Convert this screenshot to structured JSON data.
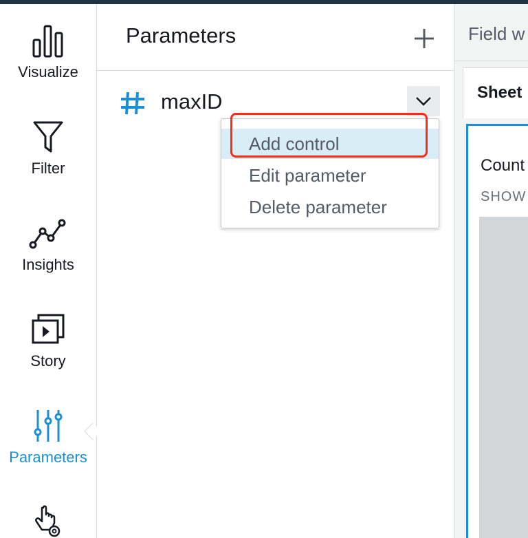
{
  "colors": {
    "accent": "#1a8fd6",
    "callout": "#ff2a14",
    "menu_highlight": "#d9edf7",
    "top_bar": "#1f3342"
  },
  "rail": {
    "items": [
      {
        "label": "Visualize",
        "icon": "bar-chart-icon"
      },
      {
        "label": "Filter",
        "icon": "funnel-icon"
      },
      {
        "label": "Insights",
        "icon": "trend-line-icon"
      },
      {
        "label": "Story",
        "icon": "play-stack-icon"
      },
      {
        "label": "Parameters",
        "icon": "sliders-icon",
        "active": true
      },
      {
        "label": "",
        "icon": "pointer-gear-icon"
      }
    ]
  },
  "panel": {
    "title": "Parameters",
    "add_icon": "plus-icon",
    "parameter": {
      "type_icon": "hash-icon",
      "name": "maxID"
    },
    "menu": {
      "items": [
        "Add control",
        "Edit parameter",
        "Delete parameter"
      ],
      "highlighted": "Add control"
    }
  },
  "right": {
    "field_tab": "Field w",
    "sheet_tab": "Sheet",
    "visual_title": "Count",
    "visual_subtitle": "SHOW"
  }
}
